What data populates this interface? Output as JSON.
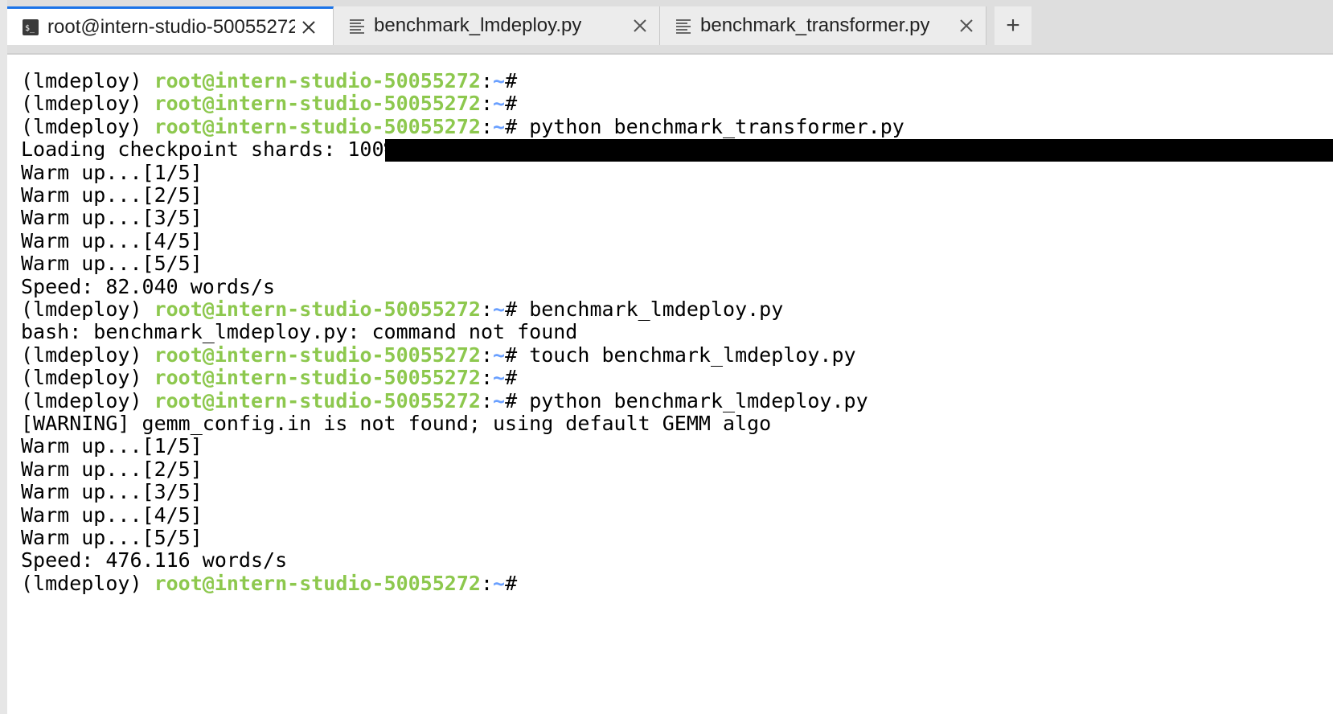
{
  "tabs": [
    {
      "label": "root@intern-studio-50055272",
      "icon": "terminal-icon",
      "active": true
    },
    {
      "label": "benchmark_lmdeploy.py",
      "icon": "file-text-icon",
      "active": false
    },
    {
      "label": "benchmark_transformer.py",
      "icon": "file-text-icon",
      "active": false
    }
  ],
  "new_tab_label": "+",
  "colors": {
    "accent": "#1a73e8",
    "host_green": "#8dc84e",
    "path_blue": "#6aa0ff"
  },
  "prompt": {
    "env": "(lmdeploy) ",
    "host": "root@intern-studio-50055272",
    "sep": ":",
    "path": "~",
    "symbol": "# "
  },
  "lines": [
    {
      "type": "prompt",
      "cmd": ""
    },
    {
      "type": "prompt",
      "cmd": ""
    },
    {
      "type": "prompt",
      "cmd": "python benchmark_transformer.py"
    },
    {
      "type": "output",
      "text": "Loading checkpoint shards: 100%|"
    },
    {
      "type": "output",
      "text": "Warm up...[1/5]"
    },
    {
      "type": "output",
      "text": "Warm up...[2/5]"
    },
    {
      "type": "output",
      "text": "Warm up...[3/5]"
    },
    {
      "type": "output",
      "text": "Warm up...[4/5]"
    },
    {
      "type": "output",
      "text": "Warm up...[5/5]"
    },
    {
      "type": "output",
      "text": "Speed: 82.040 words/s"
    },
    {
      "type": "prompt",
      "cmd": "benchmark_lmdeploy.py"
    },
    {
      "type": "output",
      "text": "bash: benchmark_lmdeploy.py: command not found"
    },
    {
      "type": "prompt",
      "cmd": "touch benchmark_lmdeploy.py"
    },
    {
      "type": "prompt",
      "cmd": ""
    },
    {
      "type": "prompt",
      "cmd": "python benchmark_lmdeploy.py"
    },
    {
      "type": "output",
      "text": "[WARNING] gemm_config.in is not found; using default GEMM algo"
    },
    {
      "type": "output",
      "text": "Warm up...[1/5]"
    },
    {
      "type": "output",
      "text": "Warm up...[2/5]"
    },
    {
      "type": "output",
      "text": "Warm up...[3/5]"
    },
    {
      "type": "output",
      "text": "Warm up...[4/5]"
    },
    {
      "type": "output",
      "text": "Warm up...[5/5]"
    },
    {
      "type": "output",
      "text": "Speed: 476.116 words/s"
    },
    {
      "type": "prompt",
      "cmd": ""
    }
  ],
  "progress": {
    "fraction": 1.0
  }
}
